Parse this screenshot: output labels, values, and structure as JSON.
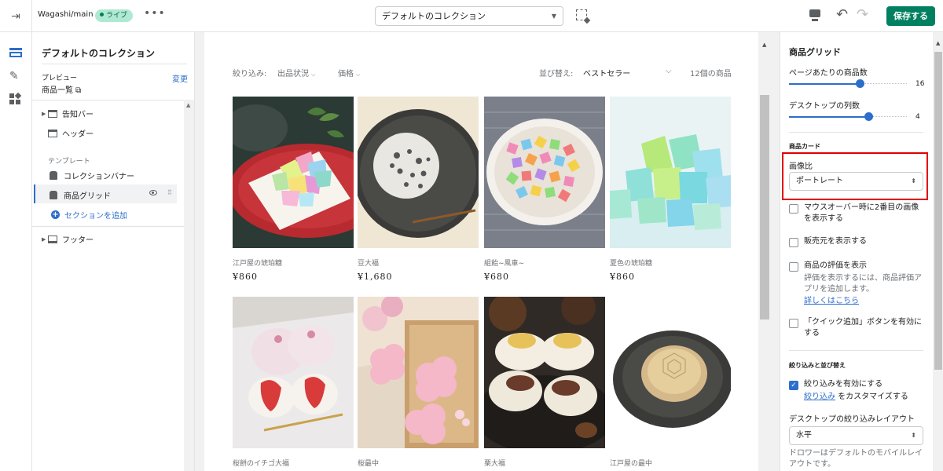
{
  "topbar": {
    "theme_name": "Wagashi/main",
    "live_badge": "ライブ",
    "more": "•••",
    "template_select": "デフォルトのコレクション",
    "save_label": "保存する",
    "colors": {
      "accent": "#008060",
      "badge_bg": "#aee9d1"
    }
  },
  "sidebar": {
    "title": "デフォルトのコレクション",
    "preview_label": "プレビュー",
    "change_label": "変更",
    "preview_page": "商品一覧 ⧉",
    "items": [
      {
        "label": "告知バー",
        "icon": "announcement-bar-icon"
      },
      {
        "label": "ヘッダー",
        "icon": "header-icon"
      },
      {
        "label": "テンプレート"
      },
      {
        "label": "コレクションバナー",
        "icon": "collection-icon"
      },
      {
        "label": "商品グリッド",
        "icon": "collection-icon"
      },
      {
        "label": "セクションを追加",
        "icon": "plus-circle-icon"
      },
      {
        "label": "フッター",
        "icon": "footer-icon"
      }
    ]
  },
  "preview": {
    "filter_label": "絞り込み:",
    "filter_availability": "出品状況",
    "filter_price": "価格",
    "sort_label": "並び替え:",
    "sort_value": "ベストセラー",
    "count": "12個の商品",
    "products": [
      {
        "name": "江戸屋の琥珀糖",
        "price": "¥860"
      },
      {
        "name": "豆大福",
        "price": "¥1,680"
      },
      {
        "name": "組飴~風車~",
        "price": "¥680"
      },
      {
        "name": "夏色の琥珀糖",
        "price": "¥860"
      },
      {
        "name": "桜餅のイチゴ大福",
        "price": ""
      },
      {
        "name": "桜最中",
        "price": ""
      },
      {
        "name": "栗大福",
        "price": ""
      },
      {
        "name": "江戸屋の最中",
        "price": ""
      }
    ]
  },
  "settings": {
    "title": "商品グリッド",
    "products_per_page_label": "ページあたりの商品数",
    "products_per_page": "16",
    "products_per_page_fraction": 0.6,
    "columns_label": "デスクトップの列数",
    "columns": "4",
    "columns_fraction": 0.67,
    "product_card_heading": "商品カード",
    "image_ratio_label": "画像比",
    "image_ratio_value": "ポートレート",
    "opt_hover_image": "マウスオーバー時に2番目の画像を表示する",
    "opt_vendor": "販売元を表示する",
    "opt_rating": "商品の評価を表示",
    "rating_note": "評価を表示するには、商品評価アプリを追加します。",
    "rating_link": "詳しくはこちら",
    "opt_quick_add": "「クイック追加」ボタンを有効にする",
    "filter_sort_heading": "絞り込みと並び替え",
    "opt_enable_filter": "絞り込みを有効にする",
    "customize_link": "絞り込み",
    "customize_suffix": " をカスタマイズする",
    "filter_layout_label": "デスクトップの絞り込みレイアウト",
    "filter_layout_value": "水平",
    "drawer_note": "ドロワーはデフォルトのモバイルレイアウトです。"
  }
}
